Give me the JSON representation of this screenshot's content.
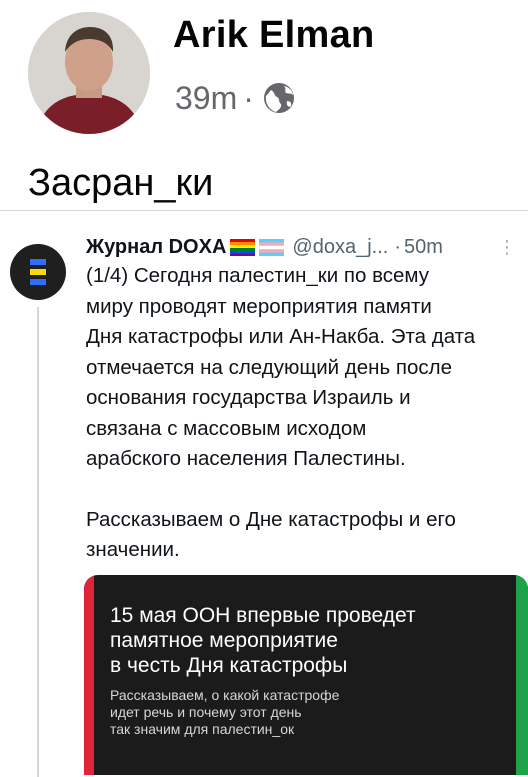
{
  "post": {
    "author": "Arik Elman",
    "time": "39m",
    "separator": "·",
    "audience_icon": "globe-icon",
    "text": "Засран_ки"
  },
  "embed": {
    "name": "Журнал DOXA",
    "flags": [
      "rainbow-flag",
      "trans-flag"
    ],
    "handle": "@doxa_j...",
    "dot": "·",
    "time": "50m",
    "more": "⋮",
    "body_lines": [
      "(1/4) Сегодня палестин_ки по всему",
      "миру проводят мероприятия памяти",
      "Дня катастрофы или Ан-Накба. Эта дата",
      "отмечается на следующий день после",
      "основания государства Израиль и",
      "связана с массовым исходом",
      "арабского населения Палестины."
    ],
    "body2_lines": [
      "Рассказываем о Дне катастрофы и его",
      "значении."
    ],
    "media": {
      "headline_lines": [
        "15 мая ООН впервые проведет",
        "памятное мероприятие",
        "в честь Дня катастрофы"
      ],
      "sub_lines": [
        "Рассказываем, о какой катастрофе",
        "идет речь и почему этот день",
        "так значим для палестин_ок"
      ]
    }
  }
}
